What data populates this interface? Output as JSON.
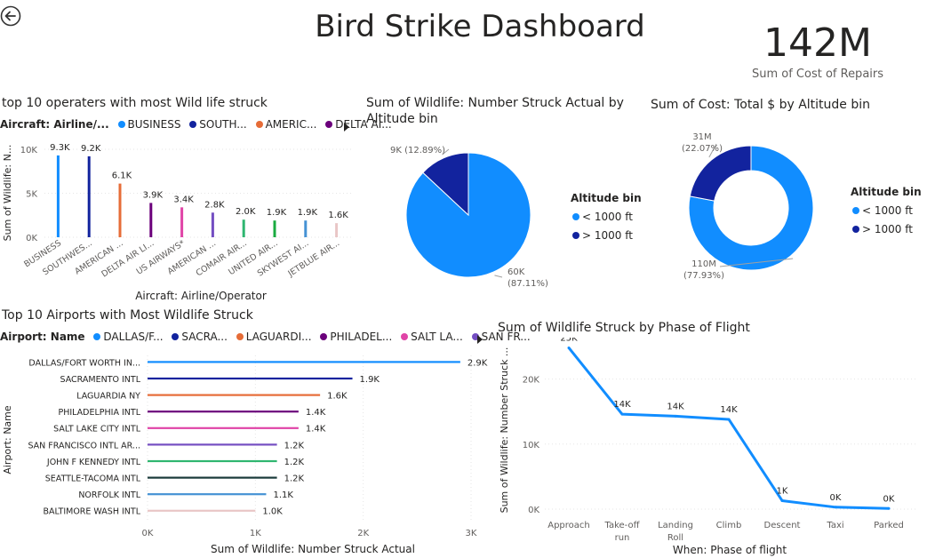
{
  "dashboard": {
    "title": "Bird Strike Dashboard",
    "kpi_value": "142M",
    "kpi_label": "Sum of Cost of Repairs"
  },
  "operators": {
    "title": "top 10 operaters with most Wild life struck",
    "legend_title": "Aircraft: Airline/...",
    "legend_items": [
      "BUSINESS",
      "SOUTH...",
      "AMERIC...",
      "DELTA AI..."
    ],
    "chart_data": {
      "type": "bar",
      "categories": [
        "BUSINESS",
        "SOUTHWES...",
        "AMERICAN ...",
        "DELTA AIR LI...",
        "US AIRWAYS*",
        "AMERICAN ...",
        "COMAIR AIR...",
        "UNITED AIR...",
        "SKYWEST AI...",
        "JETBLUE AIR..."
      ],
      "values": [
        9300,
        9200,
        6100,
        3900,
        3400,
        2800,
        2000,
        1900,
        1900,
        1600
      ],
      "data_labels": [
        "9.3K",
        "9.2K",
        "6.1K",
        "3.9K",
        "3.4K",
        "2.8K",
        "2.0K",
        "1.9K",
        "1.9K",
        "1.6K"
      ],
      "colors": [
        "#118dff",
        "#12239e",
        "#e66c37",
        "#6b007b",
        "#e044a7",
        "#744ec2",
        "#2fb670",
        "#1aab40",
        "#4592d4",
        "#e9c6c6"
      ],
      "xlabel": "Aircraft: Airline/Operator",
      "ylabel": "Sum of Wildlife: N...",
      "yticks": [
        "0K",
        "5K",
        "10K"
      ],
      "ylim": [
        0,
        10000
      ]
    }
  },
  "altitude_struck": {
    "title": "Sum of Wildlife: Number Struck Actual by Altitude bin",
    "legend_title": "Altitude bin",
    "legend_items": [
      "< 1000 ft",
      "> 1000 ft"
    ],
    "chart_data": {
      "type": "pie",
      "categories": [
        "< 1000 ft",
        "> 1000 ft"
      ],
      "values": [
        60000,
        9000
      ],
      "percents": [
        87.11,
        12.89
      ],
      "labels": [
        "60K (87.11%)",
        "9K (12.89%)"
      ],
      "colors": [
        "#118dff",
        "#12239e"
      ]
    }
  },
  "altitude_cost": {
    "title": "Sum of Cost: Total $ by Altitude bin",
    "legend_title": "Altitude bin",
    "legend_items": [
      "< 1000 ft",
      "> 1000 ft"
    ],
    "chart_data": {
      "type": "pie",
      "donut": true,
      "categories": [
        "< 1000 ft",
        "> 1000 ft"
      ],
      "values": [
        110000000,
        31000000
      ],
      "percents": [
        77.93,
        22.07
      ],
      "labels": [
        "110M (77.93%)",
        "31M (22.07%)"
      ],
      "colors": [
        "#118dff",
        "#12239e"
      ]
    }
  },
  "airports": {
    "title": "Top 10 Airports with Most Wildlife Struck",
    "legend_title": "Airport: Name",
    "legend_items": [
      "DALLAS/F...",
      "SACRA...",
      "LAGUARDI...",
      "PHILADEL...",
      "SALT LA...",
      "SAN FR..."
    ],
    "chart_data": {
      "type": "bar",
      "orientation": "horizontal",
      "categories": [
        "DALLAS/FORT WORTH IN...",
        "SACRAMENTO INTL",
        "LAGUARDIA NY",
        "PHILADELPHIA INTL",
        "SALT LAKE CITY INTL",
        "SAN FRANCISCO INTL AR...",
        "JOHN F KENNEDY INTL",
        "SEATTLE-TACOMA INTL",
        "NORFOLK INTL",
        "BALTIMORE WASH INTL"
      ],
      "values": [
        2900,
        1900,
        1600,
        1400,
        1400,
        1200,
        1200,
        1200,
        1100,
        1000
      ],
      "data_labels": [
        "2.9K",
        "1.9K",
        "1.6K",
        "1.4K",
        "1.4K",
        "1.2K",
        "1.2K",
        "1.2K",
        "1.1K",
        "1.0K"
      ],
      "colors": [
        "#118dff",
        "#12239e",
        "#e66c37",
        "#6b007b",
        "#e044a7",
        "#744ec2",
        "#2fb670",
        "#1a3a3a",
        "#4592d4",
        "#e9c6c6"
      ],
      "xlabel": "Sum of Wildlife: Number Struck Actual",
      "ylabel": "Airport: Name",
      "xticks": [
        "0K",
        "1K",
        "2K",
        "3K"
      ],
      "xlim": [
        0,
        3000
      ]
    }
  },
  "phase": {
    "title": "Sum of Wildlife Struck by Phase of Flight",
    "chart_data": {
      "type": "line",
      "categories": [
        "Approach",
        "Take-off run",
        "Landing Roll",
        "Climb",
        "Descent",
        "Taxi",
        "Parked"
      ],
      "values": [
        25000,
        14000,
        14000,
        14000,
        1000,
        0,
        0
      ],
      "plot_values": [
        24800,
        14600,
        14300,
        13800,
        1300,
        300,
        100
      ],
      "data_labels": [
        "25K",
        "14K",
        "14K",
        "14K",
        "1K",
        "0K",
        "0K"
      ],
      "color": "#118dff",
      "xlabel": "When: Phase of flight",
      "ylabel": "Sum of Wildlife: Number Struck ...",
      "yticks": [
        "0K",
        "10K",
        "20K"
      ],
      "ylim": [
        0,
        25000
      ]
    }
  }
}
